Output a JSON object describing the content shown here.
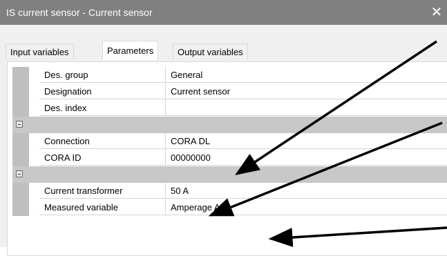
{
  "window": {
    "title": "IS current sensor - Current sensor",
    "close_glyph": "✕"
  },
  "tabs": [
    {
      "label": "Input variables",
      "active": false
    },
    {
      "label": "Parameters",
      "active": true
    },
    {
      "label": "Output variables",
      "active": false
    }
  ],
  "properties": {
    "group1": [
      {
        "name": "Des. group",
        "value": "General"
      },
      {
        "name": "Designation",
        "value": "Current sensor"
      },
      {
        "name": "Des. index",
        "value": ""
      }
    ],
    "group2": [
      {
        "name": "Connection",
        "value": "CORA DL"
      },
      {
        "name": "CORA ID",
        "value": "00000000"
      }
    ],
    "group3": [
      {
        "name": "Current transformer",
        "value": "50 A"
      },
      {
        "name": "Measured variable",
        "value": "Amperage A"
      }
    ]
  },
  "colors": {
    "titlebar": "#808080",
    "group_row": "#c8c8c8",
    "arrow": "#000000"
  }
}
